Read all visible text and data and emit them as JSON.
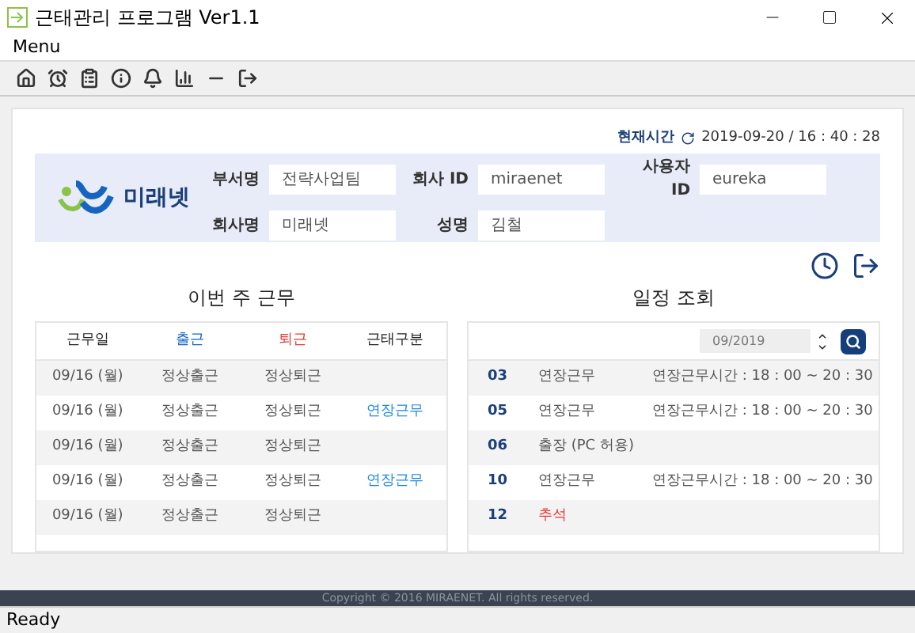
{
  "window": {
    "title": "근태관리 프로그램 Ver1.1"
  },
  "menu": [
    "Menu"
  ],
  "header": {
    "time_label": "현재시간",
    "time_value": "2019-09-20 / 16 : 40 : 28"
  },
  "profile": {
    "logo_text": "미래넷",
    "fields": [
      {
        "label": "부서명",
        "value": "전략사업팀"
      },
      {
        "label": "회사 ID",
        "value": "miraenet"
      },
      {
        "label": "사용자 ID",
        "value": "eureka"
      },
      {
        "label": "회사명",
        "value": "미래넷"
      },
      {
        "label": "성명",
        "value": "김철"
      }
    ]
  },
  "week": {
    "title": "이번 주 근무",
    "columns": [
      "근무일",
      "출근",
      "퇴근",
      "근태구분"
    ],
    "rows": [
      {
        "date": "09/16 (월)",
        "in": "정상출근",
        "out": "정상퇴근"
      },
      {
        "date": "09/16 (월)",
        "in": "정상출근",
        "out": "정상퇴근",
        "category": "연장근무"
      },
      {
        "date": "09/16 (월)",
        "in": "정상출근",
        "out": "정상퇴근"
      },
      {
        "date": "09/16 (월)",
        "in": "정상출근",
        "out": "정상퇴근",
        "category": "연장근무"
      },
      {
        "date": "09/16 (월)",
        "in": "정상출근",
        "out": "정상퇴근"
      }
    ]
  },
  "schedule": {
    "title": "일정 조회",
    "month": "09/2019",
    "rows": [
      {
        "day": "03",
        "kind": "normal",
        "type": "연장근무",
        "detail": "연장근무시간 : 18 : 00 ~ 20 : 30"
      },
      {
        "day": "05",
        "kind": "normal",
        "type": "연장근무",
        "detail": "연장근무시간 : 18 : 00 ~ 20 : 30"
      },
      {
        "day": "06",
        "kind": "normal",
        "type": "출장 (PC 허용)"
      },
      {
        "day": "10",
        "kind": "normal",
        "type": "연장근무",
        "detail": "연장근무시간 : 18 : 00 ~ 20 : 30"
      },
      {
        "day": "12",
        "kind": "holiday",
        "type": "추석"
      }
    ]
  },
  "footer": {
    "copyright": "Copyright © 2016 MIRAENET. All rights reserved."
  },
  "status_bar": {
    "text": "Ready"
  }
}
